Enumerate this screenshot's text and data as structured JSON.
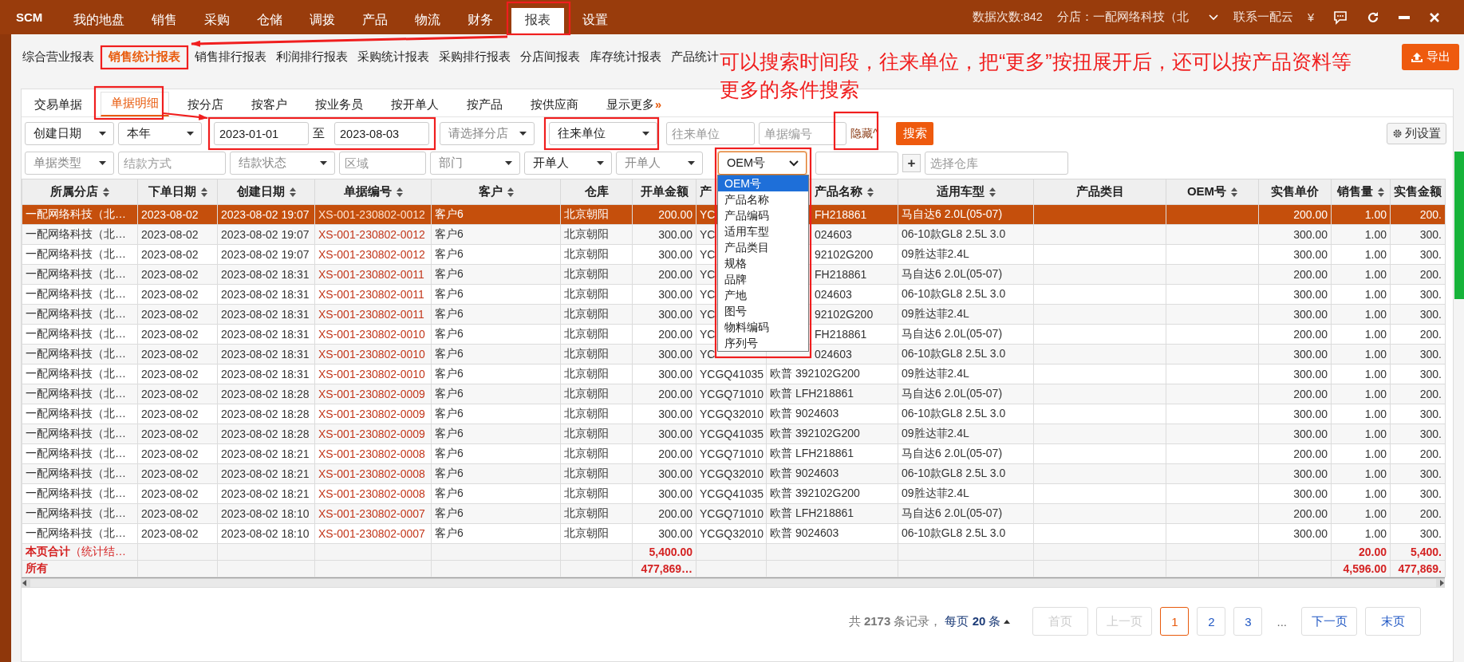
{
  "top_nav": {
    "brand": "SCM",
    "items": [
      {
        "label": "我的地盘",
        "selected": false
      },
      {
        "label": "销售",
        "selected": false
      },
      {
        "label": "采购",
        "selected": false
      },
      {
        "label": "仓储",
        "selected": false
      },
      {
        "label": "调拨",
        "selected": false
      },
      {
        "label": "产品",
        "selected": false
      },
      {
        "label": "物流",
        "selected": false
      },
      {
        "label": "财务",
        "selected": false
      },
      {
        "label": "报表",
        "selected": true
      },
      {
        "label": "设置",
        "selected": false
      }
    ],
    "data_count": "数据次数:842",
    "branch": "分店：一配网络科技（北",
    "contact": "联系一配云",
    "currency": "¥"
  },
  "sub_nav": {
    "items": [
      {
        "label": "综合营业报表",
        "selected": false
      },
      {
        "label": "销售统计报表",
        "selected": true
      },
      {
        "label": "销售排行报表",
        "selected": false
      },
      {
        "label": "利润排行报表",
        "selected": false
      },
      {
        "label": "采购统计报表",
        "selected": false
      },
      {
        "label": "采购排行报表",
        "selected": false
      },
      {
        "label": "分店间报表",
        "selected": false
      },
      {
        "label": "库存统计报表",
        "selected": false
      },
      {
        "label": "产品统计",
        "selected": false
      }
    ],
    "export_button": "导出"
  },
  "tabs": [
    {
      "label": "交易单据",
      "selected": false
    },
    {
      "label": "单据明细",
      "selected": true
    },
    {
      "label": "按分店",
      "selected": false
    },
    {
      "label": "按客户",
      "selected": false
    },
    {
      "label": "按业务员",
      "selected": false
    },
    {
      "label": "按开单人",
      "selected": false
    },
    {
      "label": "按产品",
      "selected": false
    },
    {
      "label": "按供应商",
      "selected": false
    }
  ],
  "more_tab": {
    "label": "显示更多",
    "arrow": "»"
  },
  "filters_row_1": [
    {
      "kind": "select",
      "value": "创建日期",
      "open": false
    },
    {
      "kind": "select",
      "value": "本年",
      "open": false
    },
    {
      "kind": "date",
      "value": "2023-01-01"
    },
    {
      "kind": "separator",
      "text": "至"
    },
    {
      "kind": "date",
      "value": "2023-08-03"
    },
    {
      "kind": "select",
      "placeholder": "请选择分店",
      "open": false
    },
    {
      "kind": "select",
      "value": "往来单位",
      "open": false
    },
    {
      "kind": "input",
      "placeholder": "往来单位"
    },
    {
      "kind": "input",
      "placeholder": "单据编号"
    },
    {
      "kind": "link",
      "label": "隐藏",
      "arrow": "^"
    },
    {
      "kind": "button",
      "label": "搜索"
    }
  ],
  "column_settings_button": "列设置",
  "filters_row_2": [
    {
      "kind": "select",
      "placeholder": "单据类型",
      "open": false
    },
    {
      "kind": "input",
      "placeholder": "结款方式"
    },
    {
      "kind": "select",
      "placeholder": "结款状态",
      "open": false
    },
    {
      "kind": "input",
      "placeholder": "区域"
    },
    {
      "kind": "select",
      "placeholder": "部门",
      "open": false
    },
    {
      "kind": "select",
      "value": "开单人",
      "open": false
    },
    {
      "kind": "select",
      "placeholder": "开单人",
      "open": false
    },
    {
      "kind": "select",
      "value": "OEM号",
      "open": true
    },
    {
      "kind": "input"
    },
    {
      "kind": "icon_button",
      "label": "+"
    },
    {
      "kind": "input",
      "placeholder": "选择仓库"
    }
  ],
  "dropdown": {
    "options": [
      {
        "label": "OEM号",
        "selected": true
      },
      {
        "label": "产品名称",
        "selected": false
      },
      {
        "label": "产品编码",
        "selected": false
      },
      {
        "label": "适用车型",
        "selected": false
      },
      {
        "label": "产品类目",
        "selected": false
      },
      {
        "label": "规格",
        "selected": false
      },
      {
        "label": "品牌",
        "selected": false
      },
      {
        "label": "产地",
        "selected": false
      },
      {
        "label": "图号",
        "selected": false
      },
      {
        "label": "物料编码",
        "selected": false
      },
      {
        "label": "序列号",
        "selected": false
      }
    ]
  },
  "table": {
    "columns": [
      {
        "label": "所属分店",
        "sortable": true,
        "kind": "text"
      },
      {
        "label": "下单日期",
        "sortable": true,
        "kind": "text"
      },
      {
        "label": "创建日期",
        "sortable": true,
        "kind": "text"
      },
      {
        "label": "单据编号",
        "sortable": true,
        "kind": "doc"
      },
      {
        "label": "客户",
        "sortable": true,
        "kind": "text"
      },
      {
        "label": "仓库",
        "sortable": false,
        "kind": "text"
      },
      {
        "label": "开单金额",
        "sortable": false,
        "kind": "number"
      },
      {
        "label": "产",
        "kind": "text"
      },
      {
        "label": "产品名称",
        "sortable": true,
        "kind": "text"
      },
      {
        "label": "适用车型",
        "sortable": true,
        "kind": "text"
      },
      {
        "label": "产品类目",
        "sortable": false,
        "kind": "blank"
      },
      {
        "label": "OEM号",
        "sortable": true,
        "kind": "blank"
      },
      {
        "label": "实售单价",
        "sortable": false,
        "kind": "number"
      },
      {
        "label": "销售量",
        "sortable": true,
        "kind": "number"
      },
      {
        "label": "实售金额",
        "sortable": false,
        "kind": "number"
      }
    ],
    "rows": [
      {
        "selected": true,
        "cells": [
          "一配网络科技（北…",
          "2023-08-02",
          "2023-08-02 19:07",
          "XS-001-230802-0012",
          "客户6",
          "北京朝阳",
          "200.00",
          "YC",
          "FH218861",
          "马自达6 2.0L(05-07)",
          "",
          "",
          "200.00",
          "1.00",
          "200."
        ]
      },
      {
        "selected": false,
        "cells": [
          "一配网络科技（北…",
          "2023-08-02",
          "2023-08-02 19:07",
          "XS-001-230802-0012",
          "客户6",
          "北京朝阳",
          "300.00",
          "YC",
          "024603",
          "06-10款GL8 2.5L 3.0",
          "",
          "",
          "300.00",
          "1.00",
          "300."
        ]
      },
      {
        "selected": false,
        "cells": [
          "一配网络科技（北…",
          "2023-08-02",
          "2023-08-02 19:07",
          "XS-001-230802-0012",
          "客户6",
          "北京朝阳",
          "300.00",
          "YC",
          "92102G200",
          "09胜达菲2.4L",
          "",
          "",
          "300.00",
          "1.00",
          "300."
        ]
      },
      {
        "selected": false,
        "cells": [
          "一配网络科技（北…",
          "2023-08-02",
          "2023-08-02 18:31",
          "XS-001-230802-0011",
          "客户6",
          "北京朝阳",
          "200.00",
          "YC",
          "FH218861",
          "马自达6 2.0L(05-07)",
          "",
          "",
          "200.00",
          "1.00",
          "200."
        ]
      },
      {
        "selected": false,
        "cells": [
          "一配网络科技（北…",
          "2023-08-02",
          "2023-08-02 18:31",
          "XS-001-230802-0011",
          "客户6",
          "北京朝阳",
          "300.00",
          "YC",
          "024603",
          "06-10款GL8 2.5L 3.0",
          "",
          "",
          "300.00",
          "1.00",
          "300."
        ]
      },
      {
        "selected": false,
        "cells": [
          "一配网络科技（北…",
          "2023-08-02",
          "2023-08-02 18:31",
          "XS-001-230802-0011",
          "客户6",
          "北京朝阳",
          "300.00",
          "YC",
          "92102G200",
          "09胜达菲2.4L",
          "",
          "",
          "300.00",
          "1.00",
          "300."
        ]
      },
      {
        "selected": false,
        "cells": [
          "一配网络科技（北…",
          "2023-08-02",
          "2023-08-02 18:31",
          "XS-001-230802-0010",
          "客户6",
          "北京朝阳",
          "200.00",
          "YC",
          "FH218861",
          "马自达6 2.0L(05-07)",
          "",
          "",
          "200.00",
          "1.00",
          "200."
        ]
      },
      {
        "selected": false,
        "cells": [
          "一配网络科技（北…",
          "2023-08-02",
          "2023-08-02 18:31",
          "XS-001-230802-0010",
          "客户6",
          "北京朝阳",
          "300.00",
          "YC",
          "024603",
          "06-10款GL8 2.5L 3.0",
          "",
          "",
          "300.00",
          "1.00",
          "300."
        ]
      },
      {
        "selected": false,
        "cells": [
          "一配网络科技（北…",
          "2023-08-02",
          "2023-08-02 18:31",
          "XS-001-230802-0010",
          "客户6",
          "北京朝阳",
          "300.00",
          "YCGQ41035",
          "欧普 392102G200",
          "09胜达菲2.4L",
          "",
          "",
          "300.00",
          "1.00",
          "300."
        ]
      },
      {
        "selected": false,
        "cells": [
          "一配网络科技（北…",
          "2023-08-02",
          "2023-08-02 18:28",
          "XS-001-230802-0009",
          "客户6",
          "北京朝阳",
          "200.00",
          "YCGQ71010",
          "欧普 LFH218861",
          "马自达6 2.0L(05-07)",
          "",
          "",
          "200.00",
          "1.00",
          "200."
        ]
      },
      {
        "selected": false,
        "cells": [
          "一配网络科技（北…",
          "2023-08-02",
          "2023-08-02 18:28",
          "XS-001-230802-0009",
          "客户6",
          "北京朝阳",
          "300.00",
          "YCGQ32010",
          "欧普 9024603",
          "06-10款GL8 2.5L 3.0",
          "",
          "",
          "300.00",
          "1.00",
          "300."
        ]
      },
      {
        "selected": false,
        "cells": [
          "一配网络科技（北…",
          "2023-08-02",
          "2023-08-02 18:28",
          "XS-001-230802-0009",
          "客户6",
          "北京朝阳",
          "300.00",
          "YCGQ41035",
          "欧普 392102G200",
          "09胜达菲2.4L",
          "",
          "",
          "300.00",
          "1.00",
          "300."
        ]
      },
      {
        "selected": false,
        "cells": [
          "一配网络科技（北…",
          "2023-08-02",
          "2023-08-02 18:21",
          "XS-001-230802-0008",
          "客户6",
          "北京朝阳",
          "200.00",
          "YCGQ71010",
          "欧普 LFH218861",
          "马自达6 2.0L(05-07)",
          "",
          "",
          "200.00",
          "1.00",
          "200."
        ]
      },
      {
        "selected": false,
        "cells": [
          "一配网络科技（北…",
          "2023-08-02",
          "2023-08-02 18:21",
          "XS-001-230802-0008",
          "客户6",
          "北京朝阳",
          "300.00",
          "YCGQ32010",
          "欧普 9024603",
          "06-10款GL8 2.5L 3.0",
          "",
          "",
          "300.00",
          "1.00",
          "300."
        ]
      },
      {
        "selected": false,
        "cells": [
          "一配网络科技（北…",
          "2023-08-02",
          "2023-08-02 18:21",
          "XS-001-230802-0008",
          "客户6",
          "北京朝阳",
          "300.00",
          "YCGQ41035",
          "欧普 392102G200",
          "09胜达菲2.4L",
          "",
          "",
          "300.00",
          "1.00",
          "300."
        ]
      },
      {
        "selected": false,
        "cells": [
          "一配网络科技（北…",
          "2023-08-02",
          "2023-08-02 18:10",
          "XS-001-230802-0007",
          "客户6",
          "北京朝阳",
          "200.00",
          "YCGQ71010",
          "欧普 LFH218861",
          "马自达6 2.0L(05-07)",
          "",
          "",
          "200.00",
          "1.00",
          "200."
        ]
      },
      {
        "selected": false,
        "cells": [
          "一配网络科技（北…",
          "2023-08-02",
          "2023-08-02 18:10",
          "XS-001-230802-0007",
          "客户6",
          "北京朝阳",
          "300.00",
          "YCGQ32010",
          "欧普 9024603",
          "06-10款GL8 2.5L 3.0",
          "",
          "",
          "300.00",
          "1.00",
          "300."
        ]
      }
    ],
    "summary_rows": [
      {
        "label": "**本页合计**（统计结…",
        "open_amount": "5,400.00",
        "quantity": "20.00",
        "total": "5,400."
      },
      {
        "label": "**所有**",
        "open_amount": "477,869…",
        "quantity": "4,596.00",
        "total": "477,869."
      }
    ]
  },
  "pagination": {
    "summary": "共 **2173** 条记录，",
    "page_size": "每页 **20** 条",
    "buttons": [
      {
        "label": "首页",
        "kind": "nav",
        "disabled": true,
        "selected": false
      },
      {
        "label": "上一页",
        "kind": "nav",
        "disabled": true,
        "selected": false
      },
      {
        "label": "1",
        "kind": "page",
        "disabled": false,
        "selected": true
      },
      {
        "label": "2",
        "kind": "page",
        "disabled": false,
        "selected": false
      },
      {
        "label": "3",
        "kind": "page",
        "disabled": false,
        "selected": false
      },
      {
        "label": "...",
        "kind": "ellipsis",
        "disabled": false,
        "selected": false
      },
      {
        "label": "下一页",
        "kind": "nav",
        "disabled": false,
        "selected": false
      },
      {
        "label": "末页",
        "kind": "nav",
        "disabled": false,
        "selected": false
      }
    ]
  },
  "annotation": {
    "lines": [
      "可以搜索时间段，往来单位，把“更多”按扭展开后，还可以按产品资料等",
      "更多的条件搜索"
    ]
  }
}
